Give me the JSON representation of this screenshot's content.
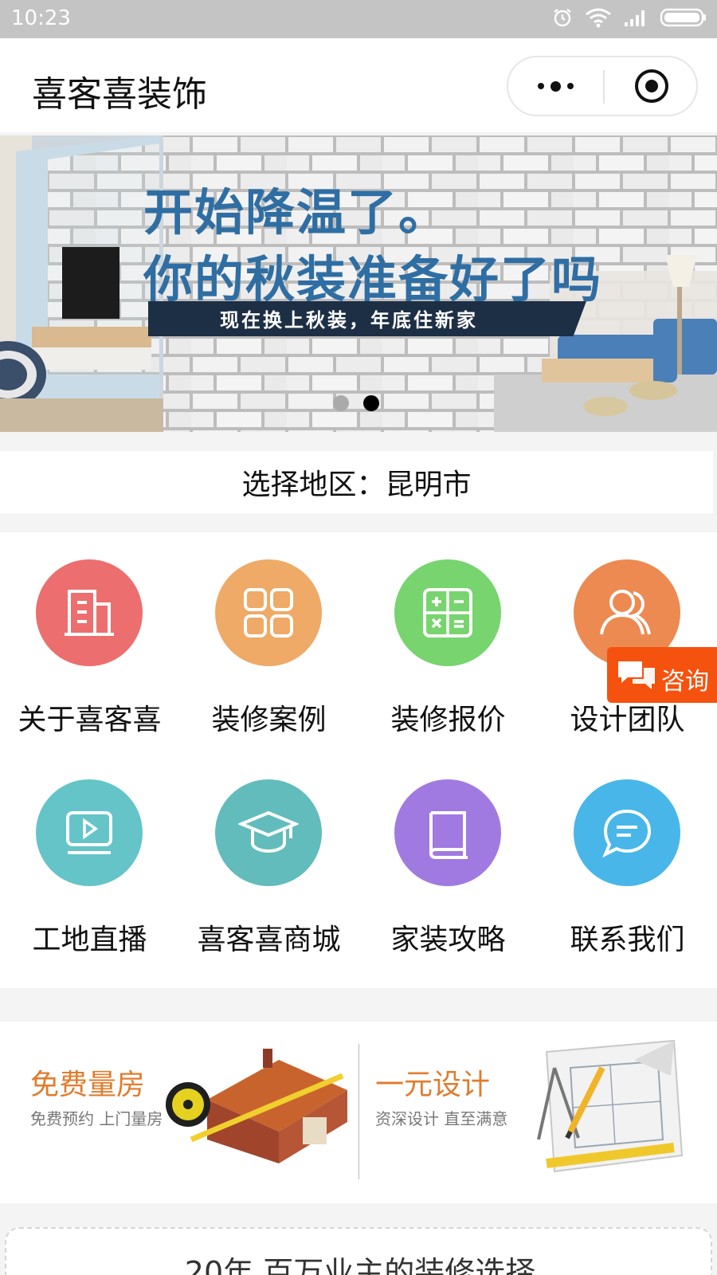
{
  "status_bar": {
    "time": "10:23"
  },
  "nav": {
    "title": "喜客喜装饰"
  },
  "banner": {
    "headline1": "开始降温了。",
    "headline2": "你的秋装准备好了吗",
    "tagline": "现在换上秋装，年底住新家"
  },
  "region": {
    "text": "选择地区：昆明市"
  },
  "menu": {
    "items": [
      {
        "label": "关于喜客喜",
        "color": "#ec6e6e",
        "icon": "building-icon"
      },
      {
        "label": "装修案例",
        "color": "#eeaa66",
        "icon": "grid-icon"
      },
      {
        "label": "装修报价",
        "color": "#78d46e",
        "icon": "calculator-icon"
      },
      {
        "label": "设计团队",
        "color": "#ec8a52",
        "icon": "team-icon"
      },
      {
        "label": "工地直播",
        "color": "#64c4c8",
        "icon": "video-icon"
      },
      {
        "label": "喜客喜商城",
        "color": "#62bcbc",
        "icon": "graduation-cap-icon"
      },
      {
        "label": "家装攻略",
        "color": "#a07ae0",
        "icon": "book-icon"
      },
      {
        "label": "联系我们",
        "color": "#48b6e8",
        "icon": "chat-bubble-icon"
      }
    ]
  },
  "consult": {
    "label": "咨询"
  },
  "promo": {
    "left_title": "免费量房",
    "left_sub": "免费预约 上门量房",
    "right_title": "一元设计",
    "right_sub": "资深设计 直至满意"
  },
  "bottom": {
    "text": "20年 百万业主的装修选择"
  }
}
